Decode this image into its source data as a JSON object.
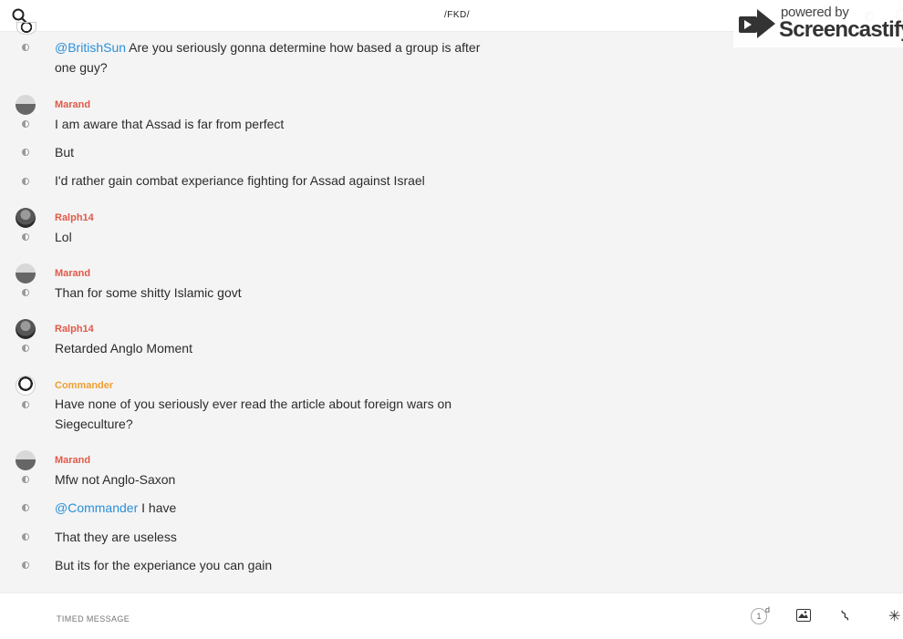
{
  "header": {
    "channel_title": "/FKD/",
    "search_icon": "search-icon",
    "watermark_powered": "powered by",
    "watermark_brand": "Screencastify"
  },
  "messages": [
    {
      "author": "",
      "lines": [
        {
          "mention": "@BritishSun",
          "text": " Are you seriously gonna determine how based a group is after one guy?"
        }
      ]
    },
    {
      "author": "Marand",
      "lines": [
        {
          "mention": "",
          "text": "I am aware that Assad is far from perfect"
        },
        {
          "mention": "",
          "text": "But"
        },
        {
          "mention": "",
          "text": "I'd rather gain combat experiance fighting for Assad against Israel"
        }
      ]
    },
    {
      "author": "Ralph14",
      "lines": [
        {
          "mention": "",
          "text": "Lol"
        }
      ]
    },
    {
      "author": "Marand",
      "lines": [
        {
          "mention": "",
          "text": "Than for some shitty Islamic govt"
        }
      ]
    },
    {
      "author": "Ralph14",
      "lines": [
        {
          "mention": "",
          "text": "Retarded Anglo Moment"
        }
      ]
    },
    {
      "author": "Commander",
      "lines": [
        {
          "mention": "",
          "text": "Have none of you seriously ever read the article about foreign wars on Siegeculture?"
        }
      ]
    },
    {
      "author": "Marand",
      "lines": [
        {
          "mention": "",
          "text": "Mfw not Anglo-Saxon"
        },
        {
          "mention": "@Commander",
          "text": " I have"
        },
        {
          "mention": "",
          "text": "That they are useless"
        },
        {
          "mention": "",
          "text": "But its for the experiance you can gain"
        }
      ]
    }
  ],
  "composer": {
    "placeholder": "TIMED MESSAGE",
    "timer_value": "1",
    "timer_unit": "d"
  },
  "colors": {
    "author_default": "#e05a47",
    "author_commander": "#f0a030",
    "mention": "#2a8fd6"
  }
}
